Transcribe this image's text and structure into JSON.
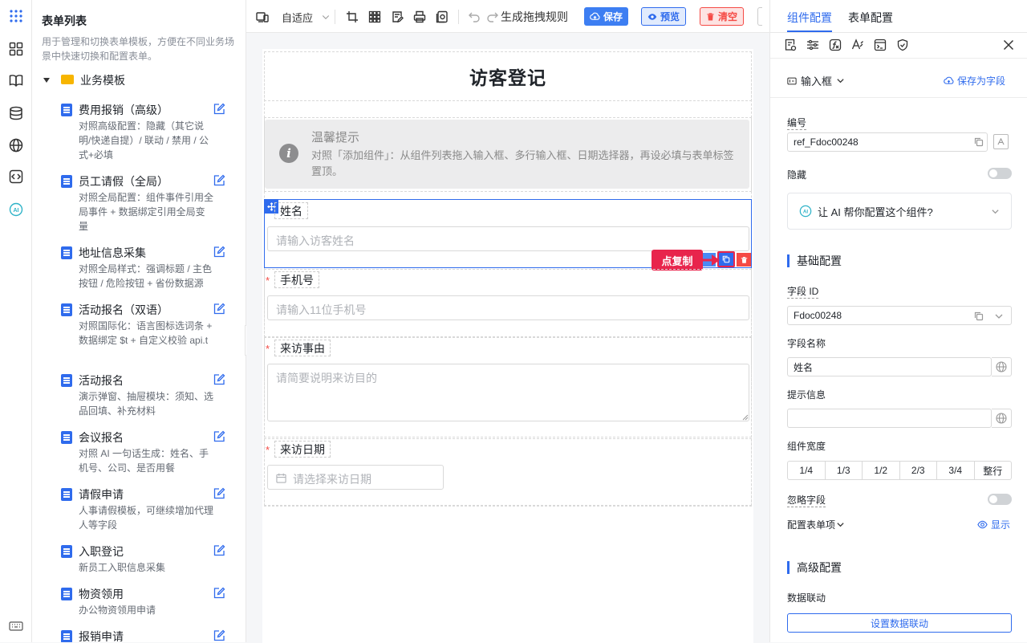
{
  "sidebar": {
    "title": "表单列表",
    "description": "用于管理和切换表单模板，方便在不同业务场景中快速切换和配置表单。",
    "folder": "业务模板",
    "templates": [
      {
        "title": "费用报销（高级）",
        "desc": "对照高级配置：隐藏（其它说明/快递自提）/ 联动 / 禁用 / 公式+必填"
      },
      {
        "title": "员工请假（全局）",
        "desc": "对照全局配置：组件事件引用全局事件 + 数据绑定引用全局变量"
      },
      {
        "title": "地址信息采集",
        "desc": "对照全局样式：强调标题 / 主色按钮 / 危险按钮 + 省份数据源"
      },
      {
        "title": "活动报名（双语）",
        "desc": "对照国际化：语言图标选词条 + 数据绑定 $t + 自定义校验 api.t"
      },
      {
        "title": "活动报名",
        "desc": "演示弹窗、抽屉模块：须知、选品回填、补充材料"
      },
      {
        "title": "会议报名",
        "desc": "对照 AI 一句话生成：姓名、手机号、公司、是否用餐"
      },
      {
        "title": "请假申请",
        "desc": "人事请假模板，可继续增加代理人等字段"
      },
      {
        "title": "入职登记",
        "desc": "新员工入职信息采集"
      },
      {
        "title": "物资领用",
        "desc": "办公物资领用申请"
      },
      {
        "title": "报销申请",
        "desc": ""
      }
    ]
  },
  "toolbar": {
    "adaptive": "自适应",
    "gen_rules": "生成拖拽规则",
    "save": "保存",
    "preview": "预览",
    "clear": "清空"
  },
  "form": {
    "title": "访客登记",
    "tip": {
      "heading": "温馨提示",
      "body": "对照「添加组件」：从组件列表拖入输入框、多行输入框、日期选择器，再设必填与表单标签置顶。"
    },
    "fields": [
      {
        "label": "姓名",
        "placeholder": "请输入访客姓名",
        "required": false
      },
      {
        "label": "手机号",
        "placeholder": "请输入11位手机号",
        "required": true
      },
      {
        "label": "来访事由",
        "placeholder": "请简要说明来访目的",
        "required": true
      },
      {
        "label": "来访日期",
        "placeholder": "请选择来访日期",
        "required": true
      }
    ],
    "copy_hint": "点复制"
  },
  "panel": {
    "tab_component": "组件配置",
    "tab_form": "表单配置",
    "component_type": "输入框",
    "save_as_field": "保存为字段",
    "number_label": "编号",
    "number_value": "ref_Fdoc00248",
    "hidden_label": "隐藏",
    "ai_prompt": "让 AI 帮你配置这个组件?",
    "basic_section": "基础配置",
    "field_id_label": "字段 ID",
    "field_id_value": "Fdoc00248",
    "field_name_label": "字段名称",
    "field_name_value": "姓名",
    "hint_label": "提示信息",
    "hint_value": "",
    "width_label": "组件宽度",
    "width_options": [
      "1/4",
      "1/3",
      "1/2",
      "2/3",
      "3/4",
      "整行"
    ],
    "ignore_label": "忽略字段",
    "config_items_label": "配置表单项",
    "show_label": "显示",
    "advanced_section": "高级配置",
    "linkage_label": "数据联动",
    "linkage_button": "设置数据联动"
  },
  "colors": {
    "accent": "#2f6bed",
    "danger": "#f54a45",
    "hint_red": "#e8254c"
  }
}
